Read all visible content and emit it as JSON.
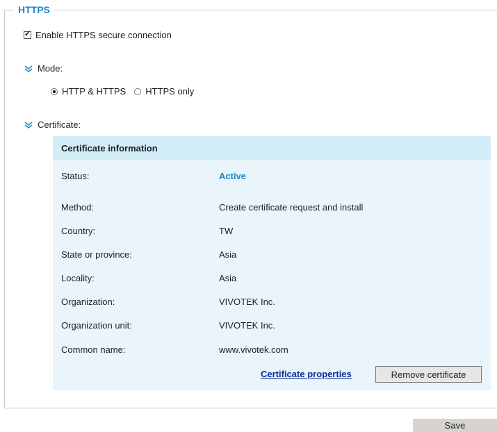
{
  "section": {
    "title": "HTTPS"
  },
  "enable": {
    "label": "Enable HTTPS secure connection",
    "checked": true
  },
  "mode": {
    "label": "Mode:",
    "options": [
      {
        "label": "HTTP & HTTPS",
        "selected": true
      },
      {
        "label": "HTTPS only",
        "selected": false
      }
    ]
  },
  "certificate": {
    "label": "Certificate:",
    "panel_title": "Certificate information",
    "rows": [
      {
        "key": "Status:",
        "value": "Active"
      },
      {
        "key": "Method:",
        "value": "Create certificate request and install"
      },
      {
        "key": "Country:",
        "value": "TW"
      },
      {
        "key": "State or province:",
        "value": "Asia"
      },
      {
        "key": "Locality:",
        "value": "Asia"
      },
      {
        "key": "Organization:",
        "value": "VIVOTEK Inc."
      },
      {
        "key": "Organization unit:",
        "value": "VIVOTEK Inc."
      },
      {
        "key": "Common name:",
        "value": "www.vivotek.com"
      }
    ],
    "properties_link": "Certificate properties",
    "remove_button": "Remove certificate"
  },
  "save_button": "Save",
  "colors": {
    "accent": "#1a86c8",
    "panel": "#e9f4fb",
    "panel_header": "#d2ecf8"
  },
  "icons": {
    "expander": "double-chevron-down-icon"
  }
}
